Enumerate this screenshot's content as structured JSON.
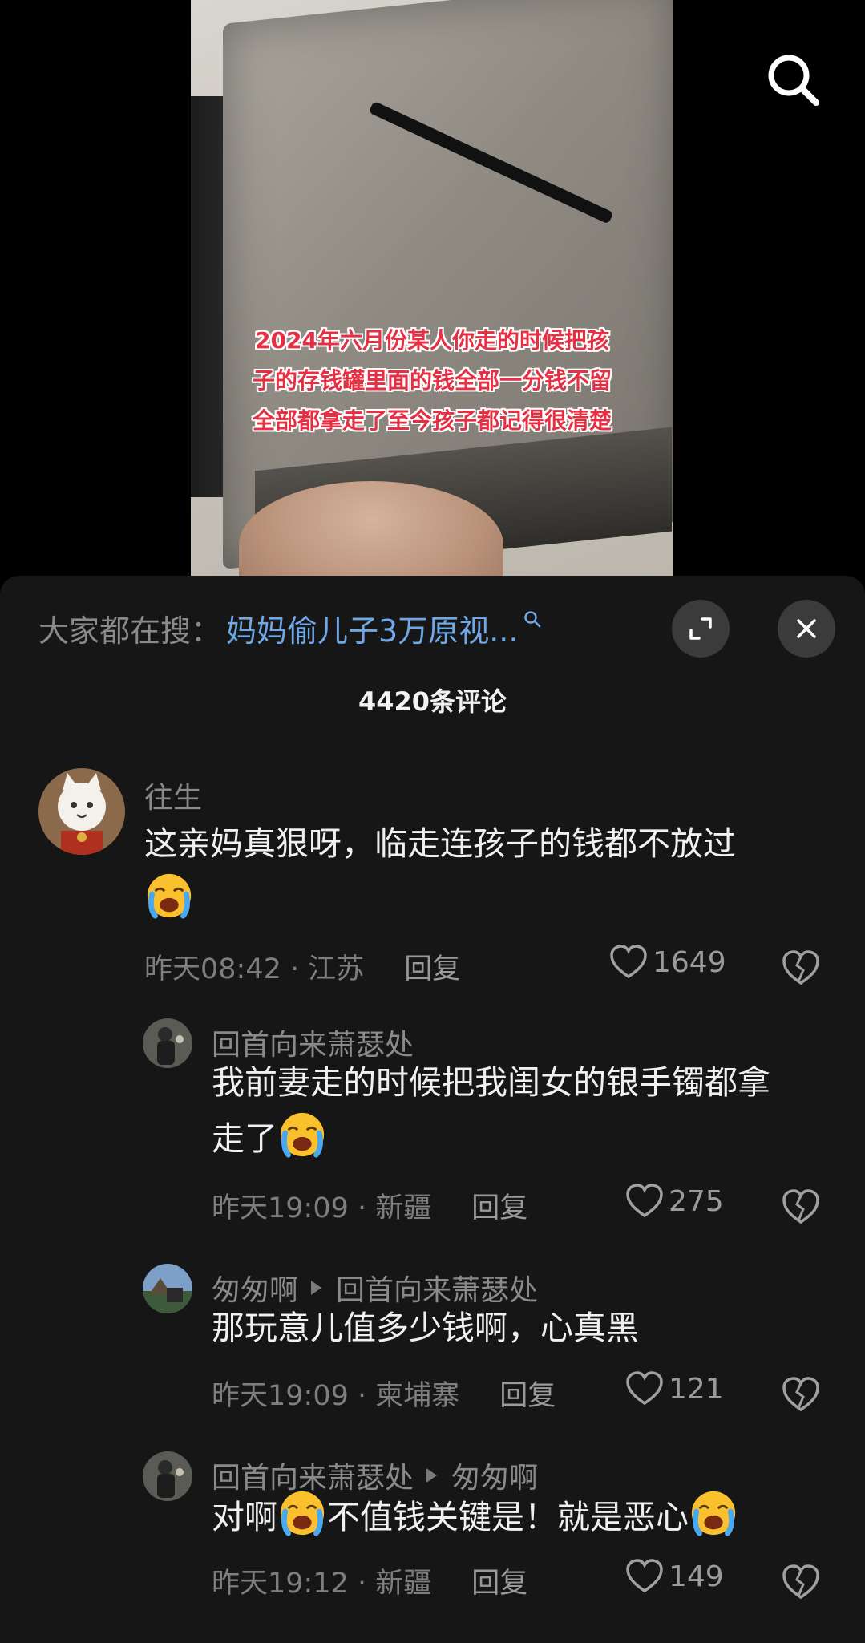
{
  "video": {
    "caption_lines": [
      "2024年六月份某人你走的时候把孩",
      "子的存钱罐里面的钱全部一分钱不留",
      "全部都拿走了至今孩子都记得很清楚"
    ]
  },
  "sheet": {
    "search_prefix": "大家都在搜：",
    "search_query": "妈妈偷儿子3万原视...",
    "comment_count": "4420条评论"
  },
  "comments": [
    {
      "username": "往生",
      "text": "这亲妈真狠呀，临走连孩子的钱都不放过",
      "time_location": "昨天08:42 · 江苏",
      "reply_label": "回复",
      "likes": "1649"
    },
    {
      "username": "回首向来萧瑟处",
      "text_line1": "我前妻走的时候把我闺女的银手镯都拿",
      "text_line2": "走了",
      "time_location": "昨天19:09 · 新疆",
      "reply_label": "回复",
      "likes": "275"
    },
    {
      "username": "匆匆啊",
      "reply_to": "回首向来萧瑟处",
      "text": "那玩意儿值多少钱啊，心真黑",
      "time_location": "昨天19:09 · 柬埔寨",
      "reply_label": "回复",
      "likes": "121"
    },
    {
      "username": "回首向来萧瑟处",
      "reply_to": "匆匆啊",
      "text_part1": "对啊",
      "text_part2": "不值钱关键是！就是恶心",
      "time_location": "昨天19:12 · 新疆",
      "reply_label": "回复",
      "likes": "149"
    }
  ],
  "colors": {
    "sheet_bg": "#161616",
    "link_blue": "#6fa8e6",
    "caption_red": "#e53043",
    "muted_text": "#7e7e7e"
  },
  "icons": [
    "search-icon",
    "expand-icon",
    "close-icon",
    "heart-icon",
    "broken-heart-icon",
    "crying-emoji-icon"
  ]
}
